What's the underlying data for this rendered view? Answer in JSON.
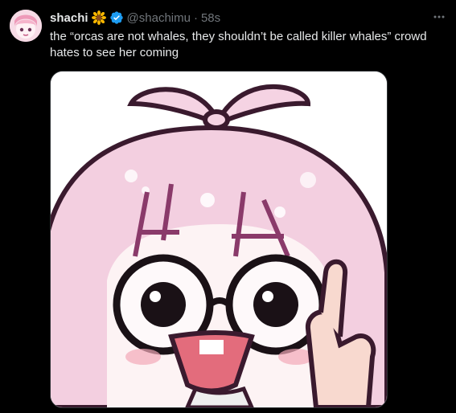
{
  "author": {
    "name": "shachi",
    "handle": "@shachimu",
    "separator": "·",
    "time": "58s",
    "badges": [
      "sunflower-emoji",
      "verified-badge-icon"
    ]
  },
  "post": {
    "text": "the “orcas are not whales, they shouldn’t be called killer whales” crowd hates to see her coming"
  },
  "media": {
    "description_icon": "anime-girl-pointing-image"
  },
  "colors": {
    "background": "#000000",
    "text": "#e7e9ea",
    "muted": "#71767b",
    "verified": "#1d9bf0",
    "hair": "#f2c9dc",
    "outline": "#8a3a6a"
  }
}
